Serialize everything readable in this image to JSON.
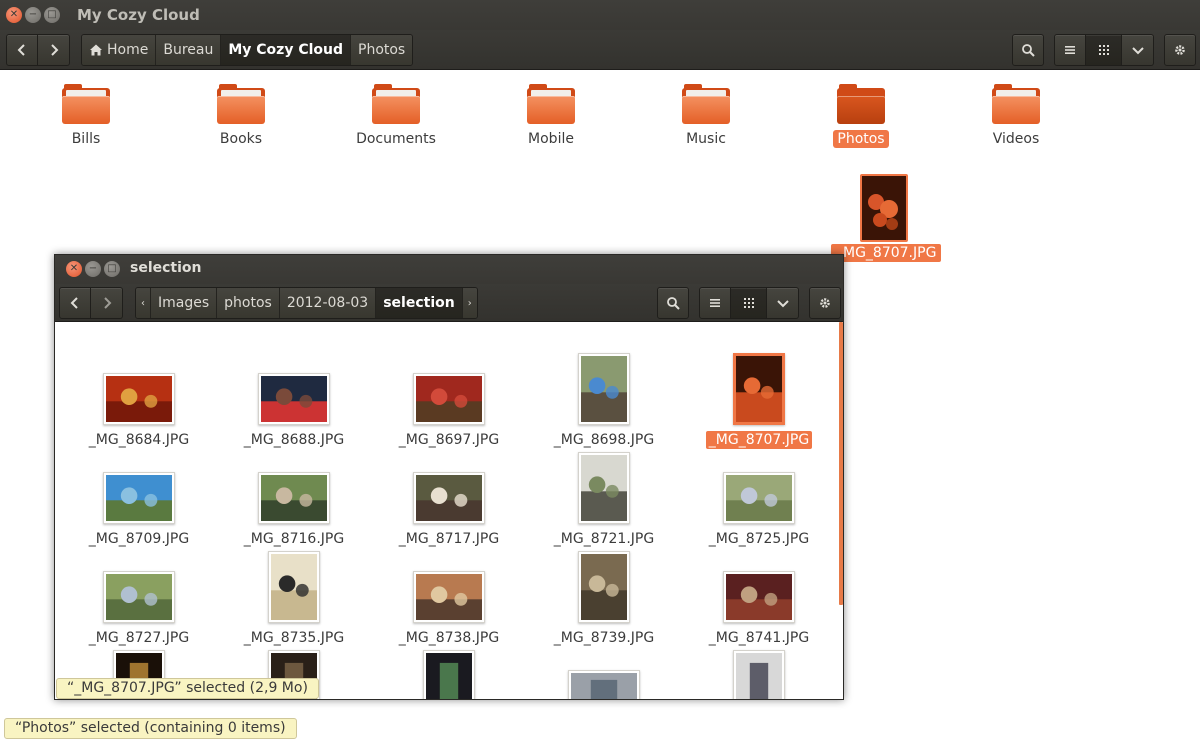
{
  "main_window": {
    "title": "My Cozy Cloud",
    "breadcrumbs": [
      "Home",
      "Bureau",
      "My Cozy Cloud",
      "Photos"
    ],
    "folders": [
      "Bills",
      "Books",
      "Documents",
      "Mobile",
      "Music",
      "Photos",
      "Videos"
    ],
    "selected_folder": "Photos",
    "status": "“Photos” selected  (containing 0 items)"
  },
  "dragged_file": {
    "name": "_MG_8707.JPG"
  },
  "selection_window": {
    "title": "selection",
    "breadcrumbs": [
      "Images",
      "photos",
      "2012-08-03",
      "selection"
    ],
    "files": [
      "_MG_8684.JPG",
      "_MG_8688.JPG",
      "_MG_8697.JPG",
      "_MG_8698.JPG",
      "_MG_8707.JPG",
      "_MG_8709.JPG",
      "_MG_8716.JPG",
      "_MG_8717.JPG",
      "_MG_8721.JPG",
      "_MG_8725.JPG",
      "_MG_8727.JPG",
      "_MG_8735.JPG",
      "_MG_8738.JPG",
      "_MG_8739.JPG",
      "_MG_8741.JPG"
    ],
    "selected_file": "_MG_8707.JPG",
    "status": "“_MG_8707.JPG” selected  (2,9 Mo)"
  },
  "colors": {
    "accent": "#f07746",
    "toolbar": "#3b3a36",
    "folder": "#e45f27",
    "tooltip": "#f9f4c2"
  },
  "icons": [
    "close-icon",
    "minimize-icon",
    "maximize-icon",
    "back-arrow-icon",
    "forward-arrow-icon",
    "home-icon",
    "search-icon",
    "list-view-icon",
    "grid-view-icon",
    "chevron-down-icon",
    "gear-icon",
    "folder-icon"
  ]
}
